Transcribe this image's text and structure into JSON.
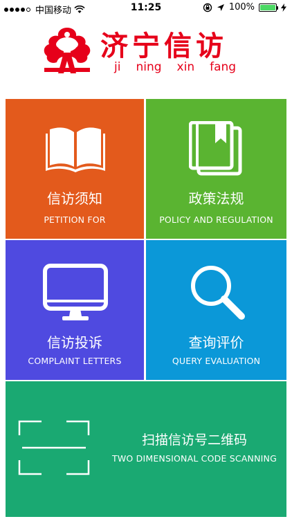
{
  "status_bar": {
    "carrier": "中国移动",
    "time": "11:25",
    "battery_percent": "100%"
  },
  "header": {
    "title": "济宁信访",
    "pinyin": [
      "ji",
      "ning",
      "xin",
      "fang"
    ]
  },
  "tiles": [
    {
      "cn": "信访须知",
      "en": "PETITION FOR",
      "icon": "open-book-icon",
      "color": "#e35a1c"
    },
    {
      "cn": "政策法规",
      "en": "POLICY AND REGULATION",
      "icon": "bookmark-books-icon",
      "color": "#5ab431"
    },
    {
      "cn": "信访投诉",
      "en": "COMPLAINT LETTERS",
      "icon": "monitor-icon",
      "color": "#4f4ae0"
    },
    {
      "cn": "查询评价",
      "en": "QUERY EVALUATION",
      "icon": "search-icon",
      "color": "#0b98d8"
    },
    {
      "cn": "扫描信访号二维码",
      "en": "TWO DIMENSIONAL CODE SCANNING",
      "icon": "qr-scan-icon",
      "color": "#1aa972"
    }
  ]
}
